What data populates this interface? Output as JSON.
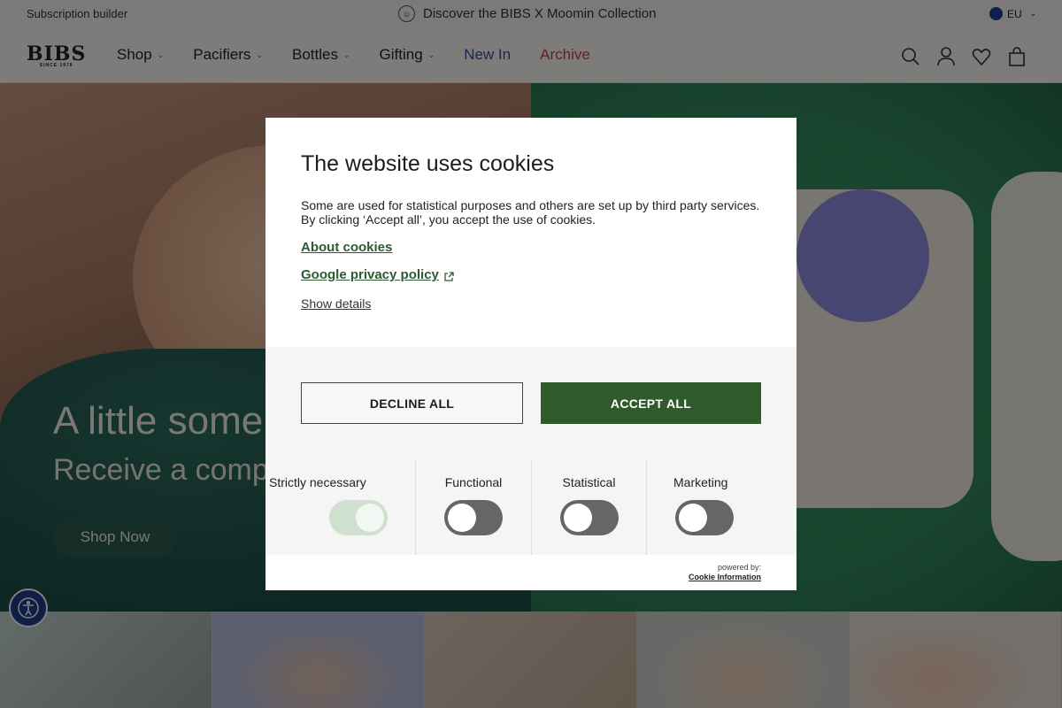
{
  "topbar": {
    "subscription": "Subscription builder",
    "promo": "Discover the BIBS X Moomin Collection",
    "region": "EU"
  },
  "header": {
    "logo": "BIBS",
    "logo_tag": "SINCE 1978",
    "nav": [
      {
        "label": "Shop",
        "has_dropdown": true
      },
      {
        "label": "Pacifiers",
        "has_dropdown": true
      },
      {
        "label": "Bottles",
        "has_dropdown": true
      },
      {
        "label": "Gifting",
        "has_dropdown": true
      },
      {
        "label": "New In",
        "has_dropdown": false
      },
      {
        "label": "Archive",
        "has_dropdown": false
      }
    ],
    "icons": [
      "search-icon",
      "account-icon",
      "wishlist-icon",
      "cart-icon"
    ]
  },
  "hero": {
    "title": "A little some",
    "subtitle_left": "Receive a comp",
    "subtitle_right": "ty favourites",
    "cta": "Shop Now"
  },
  "cookie_modal": {
    "title": "The website uses cookies",
    "description": "Some are used for statistical purposes and others are set up by third party services. By clicking ‘Accept all’, you accept the use of cookies.",
    "about_link": "About cookies",
    "google_link": "Google privacy policy",
    "show_details": "Show details",
    "decline": "DECLINE ALL",
    "accept": "ACCEPT ALL",
    "categories": [
      {
        "label": "Strictly necessary",
        "enabled": true,
        "locked": true
      },
      {
        "label": "Functional",
        "enabled": false
      },
      {
        "label": "Statistical",
        "enabled": false
      },
      {
        "label": "Marketing",
        "enabled": false
      }
    ],
    "powered_by": "powered by:",
    "provider": "Cookie Information"
  },
  "colors": {
    "accent_green": "#2e5a2c",
    "link_green": "#2d5a34",
    "new_in": "#3b4a9c",
    "archive": "#c44545"
  }
}
